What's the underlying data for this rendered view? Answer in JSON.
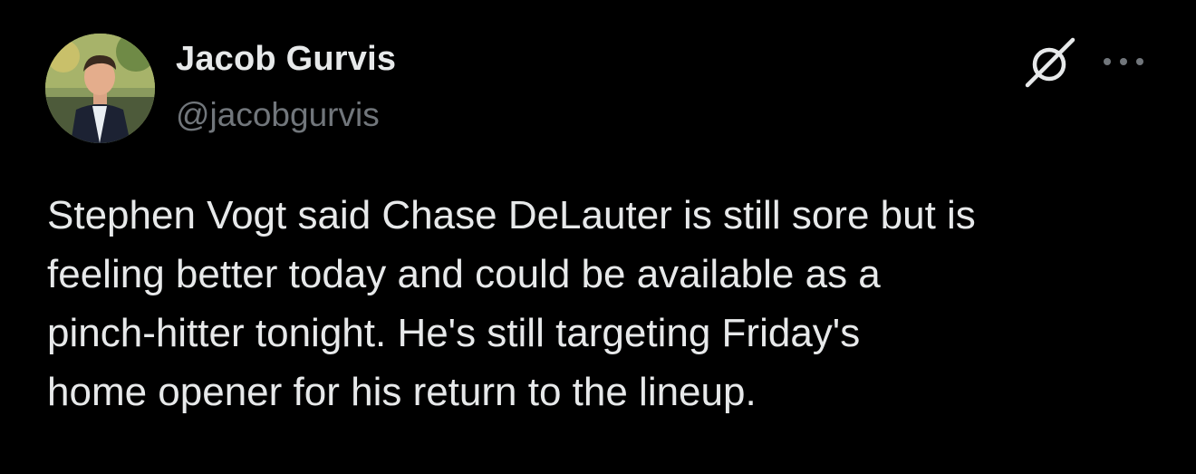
{
  "author": {
    "name": "Jacob Gurvis",
    "handle": "@jacobgurvis",
    "avatar_icon": "profile-photo"
  },
  "icons": {
    "grok": "grok-icon",
    "more": "more-options-icon"
  },
  "tweet": {
    "text": "Stephen Vogt said Chase DeLauter is still sore but is\nfeeling better today and could be available as a\npinch-hitter tonight. He's still targeting Friday's\nhome opener for his return to the lineup."
  },
  "colors": {
    "background": "#000000",
    "primary_text": "#e7e9ea",
    "secondary_text": "#71767b"
  }
}
